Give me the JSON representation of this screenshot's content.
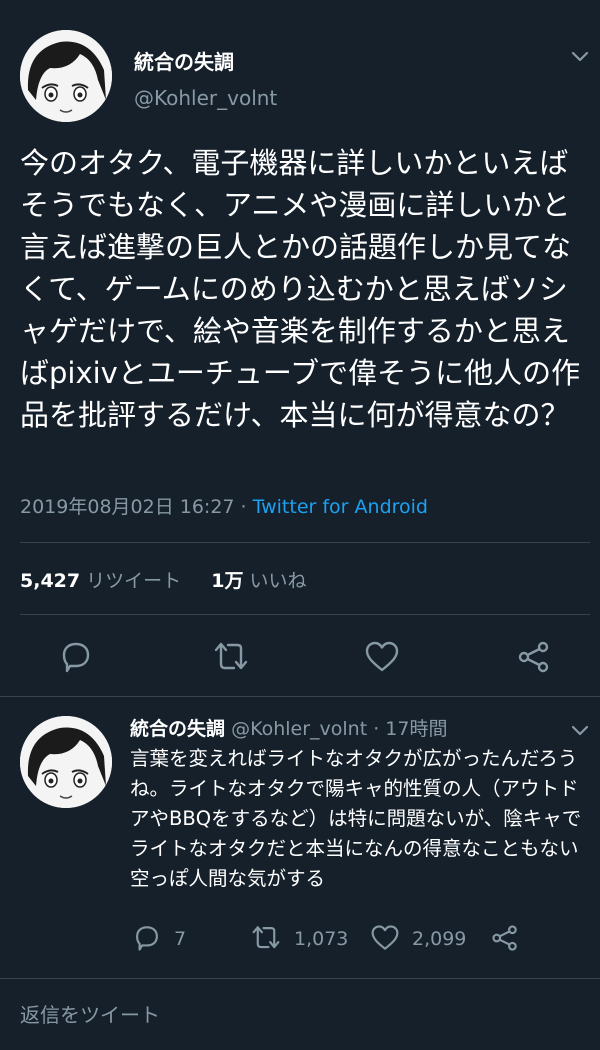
{
  "tweet": {
    "display_name": "統合の失調",
    "handle": "@Kohler_volnt",
    "text": "今のオタク、電子機器に詳しいかといえばそうでもなく、アニメや漫画に詳しいかと言えば進撃の巨人とかの話題作しか見てなくて、ゲームにのめり込むかと思えばソシャゲだけで、絵や音楽を制作するかと思えばpixivとユーチューブで偉そうに他人の作品を批評するだけ、本当に何が得意なの？",
    "timestamp": "2019年08月02日 16:27",
    "separator": " · ",
    "client": "Twitter for Android",
    "retweet_count": "5,427",
    "retweet_label": "リツイート",
    "like_count": "1万",
    "like_label": "いいね"
  },
  "reply": {
    "display_name": "統合の失調",
    "handle": "@Kohler_volnt",
    "time": "· 17時間",
    "text": "言葉を変えればライトなオタクが広がったんだろうね。ライトなオタクで陽キャ的性質の人（アウトドアやBBQをするなど）は特に問題ないが、陰キャでライトなオタクだと本当になんの得意なこともない空っぽ人間な気がする",
    "reply_count": "7",
    "retweet_count": "1,073",
    "like_count": "2,099"
  },
  "compose": {
    "placeholder": "返信をツイート"
  },
  "icons": [
    "chevron-down-icon",
    "reply-icon",
    "retweet-icon",
    "like-icon",
    "share-icon"
  ],
  "colors": {
    "background": "#15202b",
    "text": "#ffffff",
    "muted": "#8899a6",
    "link": "#1da1f2",
    "divider": "#38444d"
  }
}
